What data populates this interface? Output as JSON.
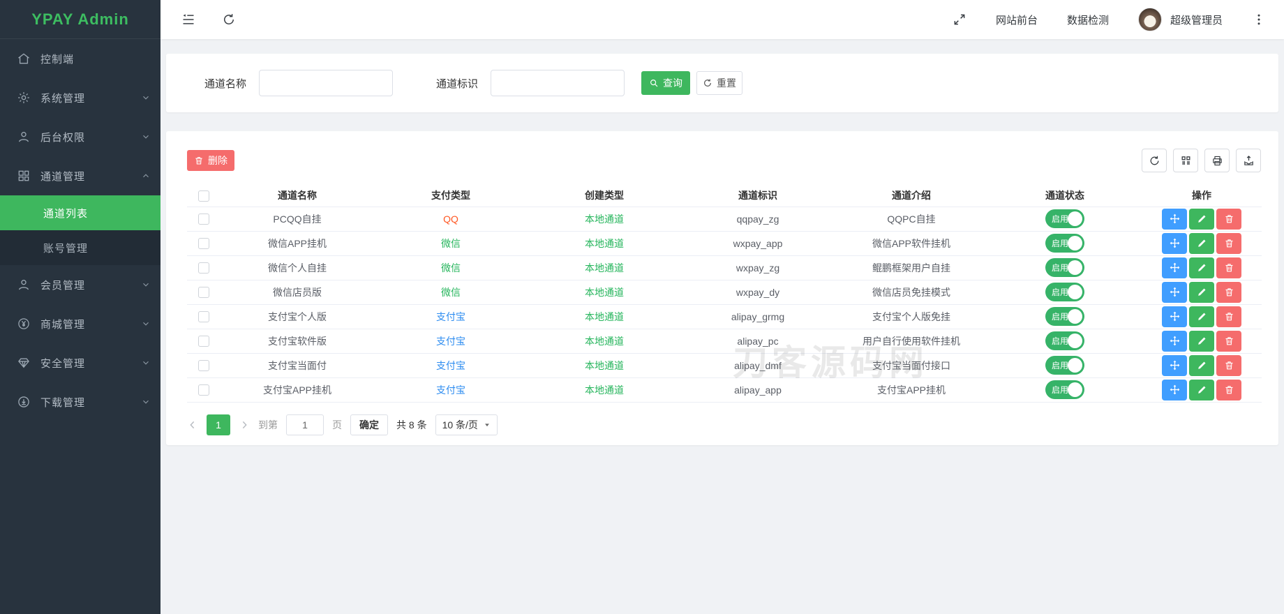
{
  "sidebar": {
    "logo": "YPAY Admin",
    "items": [
      {
        "label": "控制端",
        "icon": "home-icon"
      },
      {
        "label": "系统管理",
        "icon": "gear-icon",
        "chevron": "down"
      },
      {
        "label": "后台权限",
        "icon": "user-icon",
        "chevron": "down"
      },
      {
        "label": "通道管理",
        "icon": "grid-icon",
        "chevron": "up",
        "children": [
          {
            "label": "通道列表",
            "active": true
          },
          {
            "label": "账号管理",
            "active": false
          }
        ]
      },
      {
        "label": "会员管理",
        "icon": "user-icon",
        "chevron": "down"
      },
      {
        "label": "商城管理",
        "icon": "yen-icon",
        "chevron": "down"
      },
      {
        "label": "安全管理",
        "icon": "shield-icon",
        "chevron": "down"
      },
      {
        "label": "下载管理",
        "icon": "download-icon",
        "chevron": "down"
      }
    ]
  },
  "header": {
    "site_link": "网站前台",
    "monitor_link": "数据检测",
    "username": "超级管理员"
  },
  "search": {
    "name_label": "通道名称",
    "code_label": "通道标识",
    "query_label": "查询",
    "reset_label": "重置"
  },
  "toolbar": {
    "delete_label": "删除"
  },
  "table": {
    "columns": [
      "通道名称",
      "支付类型",
      "创建类型",
      "通道标识",
      "通道介绍",
      "通道状态",
      "操作"
    ],
    "rows": [
      {
        "name": "PCQQ自挂",
        "pay_type": "QQ",
        "pay_type_color": "#ff5722",
        "create_type": "本地通道",
        "code": "qqpay_zg",
        "intro": "QQPC自挂",
        "status": "启用"
      },
      {
        "name": "微信APP挂机",
        "pay_type": "微信",
        "pay_type_color": "#26b55c",
        "create_type": "本地通道",
        "code": "wxpay_app",
        "intro": "微信APP软件挂机",
        "status": "启用"
      },
      {
        "name": "微信个人自挂",
        "pay_type": "微信",
        "pay_type_color": "#26b55c",
        "create_type": "本地通道",
        "code": "wxpay_zg",
        "intro": "鲲鹏框架用户自挂",
        "status": "启用"
      },
      {
        "name": "微信店员版",
        "pay_type": "微信",
        "pay_type_color": "#26b55c",
        "create_type": "本地通道",
        "code": "wxpay_dy",
        "intro": "微信店员免挂模式",
        "status": "启用"
      },
      {
        "name": "支付宝个人版",
        "pay_type": "支付宝",
        "pay_type_color": "#2d8cf0",
        "create_type": "本地通道",
        "code": "alipay_grmg",
        "intro": "支付宝个人版免挂",
        "status": "启用"
      },
      {
        "name": "支付宝软件版",
        "pay_type": "支付宝",
        "pay_type_color": "#2d8cf0",
        "create_type": "本地通道",
        "code": "alipay_pc",
        "intro": "用户自行使用软件挂机",
        "status": "启用"
      },
      {
        "name": "支付宝当面付",
        "pay_type": "支付宝",
        "pay_type_color": "#2d8cf0",
        "create_type": "本地通道",
        "code": "alipay_dmf",
        "intro": "支付宝当面付接口",
        "status": "启用"
      },
      {
        "name": "支付宝APP挂机",
        "pay_type": "支付宝",
        "pay_type_color": "#2d8cf0",
        "create_type": "本地通道",
        "code": "alipay_app",
        "intro": "支付宝APP挂机",
        "status": "启用"
      }
    ]
  },
  "pagination": {
    "page": "1",
    "goto_prefix": "到第",
    "goto_value": "1",
    "goto_suffix": "页",
    "confirm_label": "确定",
    "total_label": "共 8 条",
    "page_size_label": "10 条/页"
  },
  "watermark": "刀客源码网",
  "colors": {
    "primary_green": "#3eb75e",
    "link_green": "#26b55c",
    "alipay_blue": "#2d8cf0",
    "qq_orange": "#ff5722",
    "op_blue": "#409eff",
    "danger_red": "#f56c6c",
    "sidebar_bg": "#28333e"
  }
}
